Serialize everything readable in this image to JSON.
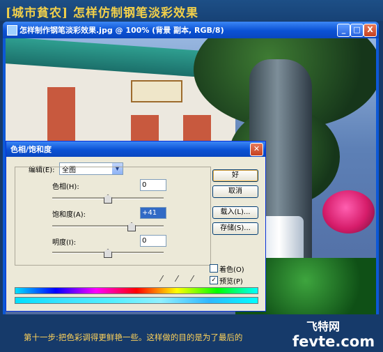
{
  "banner": {
    "title": "[城市貧农]  怎样仿制钢笔淡彩效果"
  },
  "document_window": {
    "title": "怎样制作钢笔淡彩效果.jpg @ 100% (背景 副本, RGB/8)",
    "buttons": [
      "_",
      "□",
      "X"
    ]
  },
  "dialog": {
    "title": "色相/饱和度",
    "edit_label": "编辑(E):",
    "edit_value": "全图",
    "hue_label": "色相(H):",
    "hue_value": "0",
    "saturation_label": "饱和度(A):",
    "saturation_value": "+41",
    "lightness_label": "明度(I):",
    "lightness_value": "0",
    "ok_label": "好",
    "cancel_label": "取消",
    "load_label": "载入(L)...",
    "save_label": "存储(S)...",
    "colorize_label": "着色(O)",
    "colorize_checked": false,
    "preview_label": "预览(P)",
    "preview_checked": true
  },
  "caption": "第十一步:把色彩调得更鲜艳一些。这样做的目的是为了最后的",
  "watermark": {
    "site_cn": "飞特网",
    "site_en": "fevte.com"
  }
}
